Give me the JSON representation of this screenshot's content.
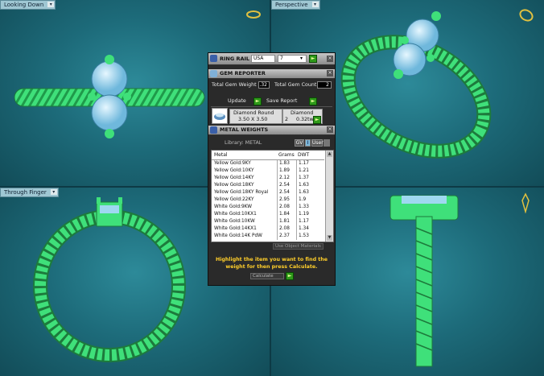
{
  "viewports": [
    {
      "label": "Looking Down"
    },
    {
      "label": "Perspective"
    },
    {
      "label": "Through Finger"
    }
  ],
  "ring_rail": {
    "title": "RING RAIL",
    "region": "USA",
    "size": "7"
  },
  "gem_reporter": {
    "title": "GEM REPORTER",
    "total_weight_label": "Total Gem Weight",
    "total_weight_value": ".32",
    "total_count_label": "Total Gem Count",
    "total_count_value": "2",
    "update_label": "Update",
    "save_report_label": "Save Report",
    "gem_name": "Diamond Round",
    "gem_size": "3.50 X 3.50",
    "gem_material": "Diamond",
    "gem_qty": "2",
    "gem_tw": "0.32tw"
  },
  "metal_weights": {
    "title": "METAL WEIGHTS",
    "library_label": "Library: METAL",
    "btn_gv": "GV",
    "btn_i": "I",
    "btn_user": "User",
    "columns": [
      "Metal",
      "Grams",
      "DWT"
    ],
    "rows": [
      {
        "metal": "Yellow Gold:9KY",
        "grams": "1.83",
        "dwt": "1.17"
      },
      {
        "metal": "Yellow Gold:10KY",
        "grams": "1.89",
        "dwt": "1.21"
      },
      {
        "metal": "Yellow Gold:14KY",
        "grams": "2.12",
        "dwt": "1.37"
      },
      {
        "metal": "Yellow Gold:18KY",
        "grams": "2.54",
        "dwt": "1.63"
      },
      {
        "metal": "Yellow Gold:18KY Royal",
        "grams": "2.54",
        "dwt": "1.63"
      },
      {
        "metal": "Yellow Gold:22KY",
        "grams": "2.95",
        "dwt": "1.9"
      },
      {
        "metal": "White Gold:9KW",
        "grams": "2.08",
        "dwt": "1.33"
      },
      {
        "metal": "White Gold:10KX1",
        "grams": "1.84",
        "dwt": "1.19"
      },
      {
        "metal": "White Gold:10KW",
        "grams": "1.81",
        "dwt": "1.17"
      },
      {
        "metal": "White Gold:14KX1",
        "grams": "2.08",
        "dwt": "1.34"
      },
      {
        "metal": "White Gold:14K PdW",
        "grams": "2.37",
        "dwt": "1.53"
      }
    ],
    "use_object_materials": "Use Object Materials",
    "hint": "Highlight the item you want to find the weight for then press Calculate.",
    "calculate_label": "Calculate"
  },
  "colors": {
    "ring": "#3fe07a",
    "gem": "#9fd8f0",
    "viewport_bg": "#1d6b7a",
    "hint": "#ffce2a",
    "go_button": "#2f9a1a"
  }
}
